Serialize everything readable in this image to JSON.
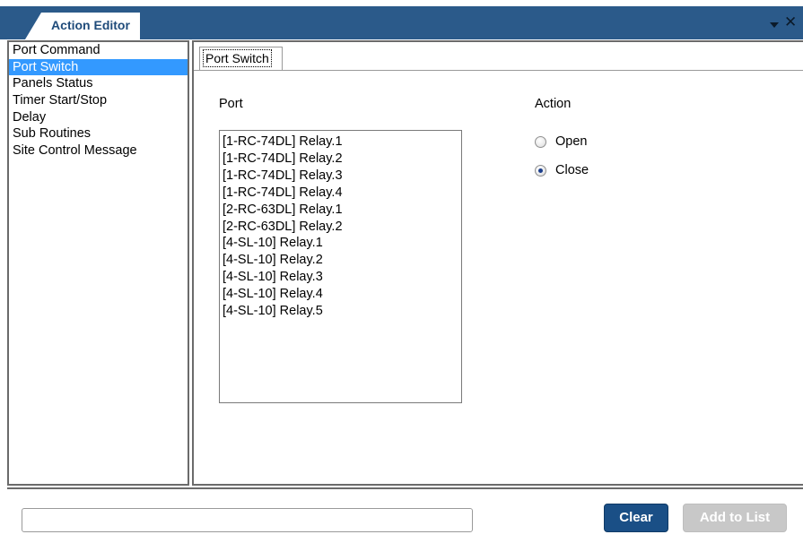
{
  "window": {
    "title": "Action Editor",
    "accent_color": "#2b5a8a",
    "icons": [
      "pin-icon",
      "close-icon"
    ],
    "close_glyph": "✕"
  },
  "action_types": {
    "items": [
      "Port Command",
      "Port Switch",
      "Panels Status",
      "Timer Start/Stop",
      "Delay",
      "Sub Routines",
      "Site Control Message"
    ],
    "selected": "Port Switch",
    "selection_color": "#3399ff"
  },
  "tab": {
    "label": "Port Switch"
  },
  "port": {
    "label": "Port",
    "items": [
      "[1-RC-74DL] Relay.1",
      "[1-RC-74DL] Relay.2",
      "[1-RC-74DL] Relay.3",
      "[1-RC-74DL] Relay.4",
      "[2-RC-63DL] Relay.1",
      "[2-RC-63DL] Relay.2",
      "[4-SL-10] Relay.1",
      "[4-SL-10] Relay.2",
      "[4-SL-10] Relay.3",
      "[4-SL-10] Relay.4",
      "[4-SL-10] Relay.5"
    ]
  },
  "action": {
    "label": "Action",
    "options": [
      "Open",
      "Close"
    ],
    "selected": "Close"
  },
  "bottom": {
    "status_value": "",
    "clear_label": "Clear",
    "add_label": "Add to List",
    "clear_color": "#1a4f86",
    "add_disabled": true
  }
}
